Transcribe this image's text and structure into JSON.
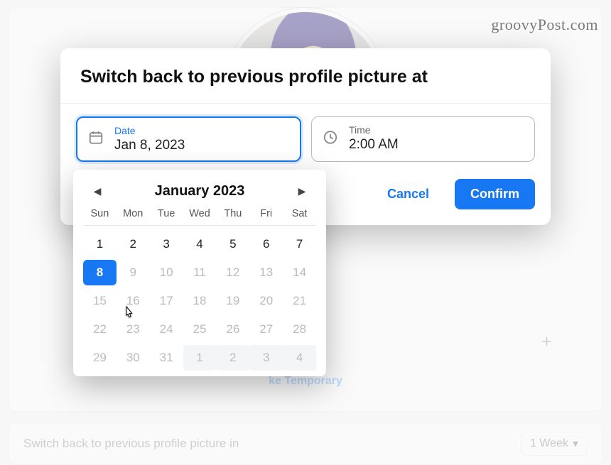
{
  "watermark": "groovyPost.com",
  "modal": {
    "title": "Switch back to previous profile picture at",
    "cancel": "Cancel",
    "confirm": "Confirm"
  },
  "fields": {
    "date": {
      "label": "Date",
      "value": "Jan 8, 2023"
    },
    "time": {
      "label": "Time",
      "value": "2:00 AM"
    }
  },
  "calendar": {
    "month": "January 2023",
    "dow": [
      "Sun",
      "Mon",
      "Tue",
      "Wed",
      "Thu",
      "Fri",
      "Sat"
    ],
    "rows": [
      [
        {
          "n": 1,
          "cls": ""
        },
        {
          "n": 2,
          "cls": ""
        },
        {
          "n": 3,
          "cls": ""
        },
        {
          "n": 4,
          "cls": ""
        },
        {
          "n": 5,
          "cls": ""
        },
        {
          "n": 6,
          "cls": ""
        },
        {
          "n": 7,
          "cls": ""
        }
      ],
      [
        {
          "n": 8,
          "cls": "sel"
        },
        {
          "n": 9,
          "cls": "dis"
        },
        {
          "n": 10,
          "cls": "dis"
        },
        {
          "n": 11,
          "cls": "dis"
        },
        {
          "n": 12,
          "cls": "dis"
        },
        {
          "n": 13,
          "cls": "dis"
        },
        {
          "n": 14,
          "cls": "dis"
        }
      ],
      [
        {
          "n": 15,
          "cls": "dis"
        },
        {
          "n": 16,
          "cls": "dis"
        },
        {
          "n": 17,
          "cls": "dis"
        },
        {
          "n": 18,
          "cls": "dis"
        },
        {
          "n": 19,
          "cls": "dis"
        },
        {
          "n": 20,
          "cls": "dis"
        },
        {
          "n": 21,
          "cls": "dis"
        }
      ],
      [
        {
          "n": 22,
          "cls": "dis"
        },
        {
          "n": 23,
          "cls": "dis"
        },
        {
          "n": 24,
          "cls": "dis"
        },
        {
          "n": 25,
          "cls": "dis"
        },
        {
          "n": 26,
          "cls": "dis"
        },
        {
          "n": 27,
          "cls": "dis"
        },
        {
          "n": 28,
          "cls": "dis"
        }
      ],
      [
        {
          "n": 29,
          "cls": "dis"
        },
        {
          "n": 30,
          "cls": "dis"
        },
        {
          "n": 31,
          "cls": "dis"
        },
        {
          "n": 1,
          "cls": "out"
        },
        {
          "n": 2,
          "cls": "out"
        },
        {
          "n": 3,
          "cls": "out"
        },
        {
          "n": 4,
          "cls": "out"
        }
      ]
    ]
  },
  "background": {
    "make_temporary": "ke Temporary",
    "switch_back_label": "Switch back to previous profile picture in",
    "dropdown_value": "1 Week",
    "plus_glyph": "+"
  }
}
